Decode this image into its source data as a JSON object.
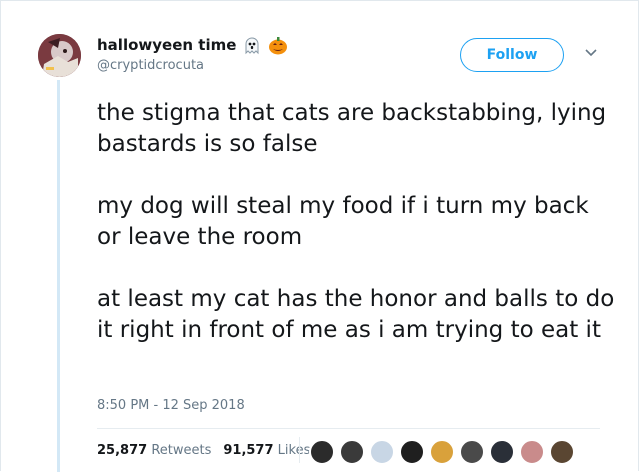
{
  "user": {
    "display_name": "hallowyeen time",
    "handle": "@cryptidcrocuta",
    "emojis": [
      "ghost-emoji",
      "jack-o-lantern-emoji"
    ]
  },
  "follow_button": {
    "label": "Follow"
  },
  "tweet": {
    "paragraphs": [
      "the stigma that cats are backstabbing, lying bastards is so false",
      "my dog will steal my food if i turn my back or leave the room",
      "at least my cat has the honor and balls to do it right in front of me as i am trying to eat it"
    ],
    "timestamp": "8:50 PM - 12 Sep 2018"
  },
  "stats": {
    "retweets_count": "25,877",
    "retweets_label": "Retweets",
    "likes_count": "91,577",
    "likes_label": "Likes"
  },
  "likers": [
    {
      "color": "#2b2b2b"
    },
    {
      "color": "#3a3a3a"
    },
    {
      "color": "#c8d6e5"
    },
    {
      "color": "#1f1f1f"
    },
    {
      "color": "#d9a13b"
    },
    {
      "color": "#4a4a4a"
    },
    {
      "color": "#2a2f38"
    },
    {
      "color": "#c98b8b"
    },
    {
      "color": "#5a4632"
    }
  ],
  "colors": {
    "accent": "#1da1f2",
    "text": "#14171a",
    "secondary_text": "#657786",
    "thread_line": "#d3e8f6"
  }
}
